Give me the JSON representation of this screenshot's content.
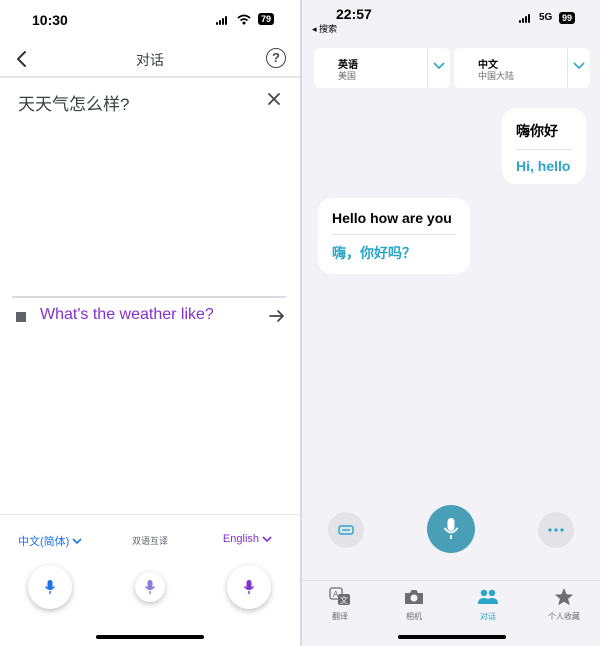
{
  "left": {
    "status": {
      "time": "10:30",
      "battery": "79"
    },
    "header": {
      "title": "对话"
    },
    "source_text": "天天气怎么样?",
    "translated_text": "What's the weather like?",
    "bottom": {
      "source_lang": "中文(简体)",
      "mode_label": "双语互译",
      "target_lang": "English"
    },
    "colors": {
      "blue": "#1a73e8",
      "purple": "#8430ce"
    }
  },
  "right": {
    "status": {
      "time": "22:57",
      "back_label": "◂ 搜索",
      "network": "5G",
      "battery": "99"
    },
    "lang_left": {
      "name": "英语",
      "region": "美国"
    },
    "lang_right": {
      "name": "中文",
      "region": "中国大陆"
    },
    "bubble_1": {
      "original": "嗨你好",
      "translation": "Hi, hello"
    },
    "bubble_2": {
      "original": "Hello how are you",
      "translation": "嗨，你好吗？"
    },
    "tabs": [
      {
        "label": "翻译",
        "icon": "translate-icon"
      },
      {
        "label": "相机",
        "icon": "camera-icon"
      },
      {
        "label": "对话",
        "icon": "people-icon"
      },
      {
        "label": "个人收藏",
        "icon": "star-icon"
      }
    ],
    "colors": {
      "accent": "#2aa5c8",
      "mic": "#4a9fb8"
    }
  }
}
